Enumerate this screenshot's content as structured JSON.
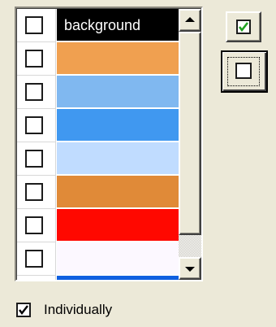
{
  "color_list": {
    "rows": [
      {
        "label": "background",
        "color": "#000000",
        "checked": false
      },
      {
        "label": "",
        "color": "#f0a050",
        "checked": false
      },
      {
        "label": "",
        "color": "#80b8f0",
        "checked": false
      },
      {
        "label": "",
        "color": "#4098f0",
        "checked": false
      },
      {
        "label": "",
        "color": "#c0dcff",
        "checked": false
      },
      {
        "label": "",
        "color": "#e08a38",
        "checked": false
      },
      {
        "label": "",
        "color": "#ff0800",
        "checked": false
      },
      {
        "label": "",
        "color": "#fcf8ff",
        "checked": false
      },
      {
        "label": "",
        "color": "#1060e0",
        "checked": false
      }
    ]
  },
  "buttons": {
    "check_all_icon": "checked-checkbox-icon",
    "uncheck_all_icon": "unchecked-checkbox-icon",
    "check_color": "#20a020"
  },
  "individually": {
    "label": "Individually",
    "checked": true
  }
}
